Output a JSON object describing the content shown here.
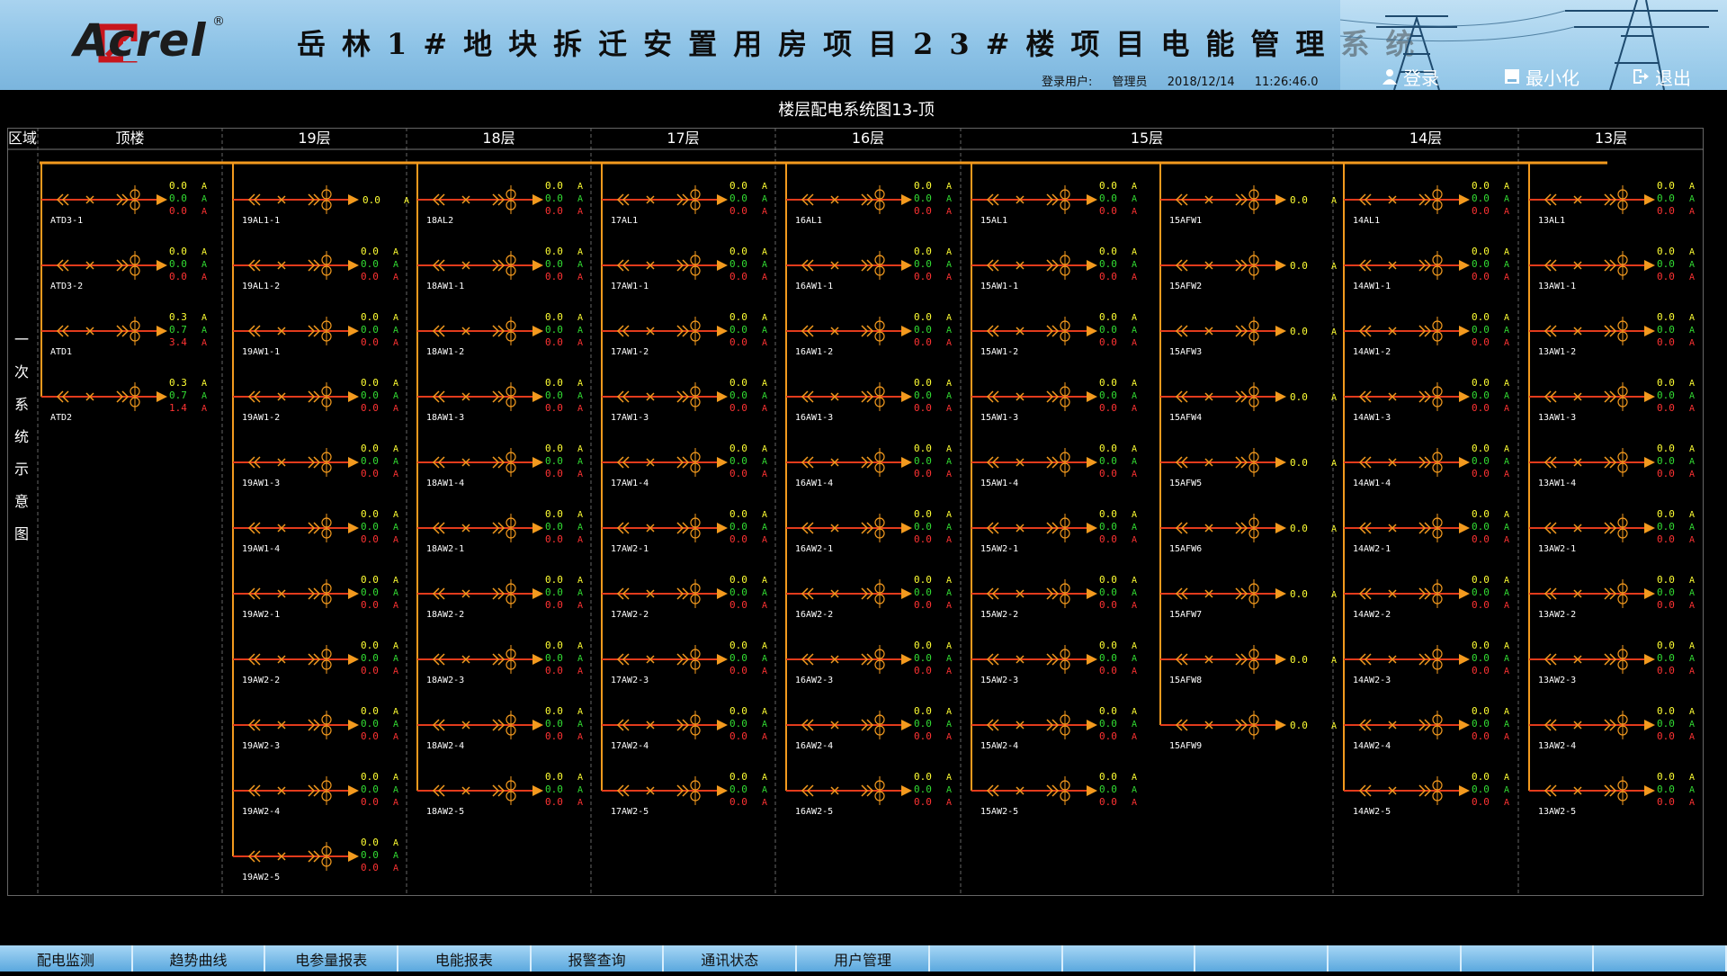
{
  "header": {
    "logo_text": "Acrel",
    "logo_reg": "®",
    "title": "岳林1#地块拆迁安置用房项目23#楼项目电能管理系统",
    "user_label": "登录用户:",
    "user_name": "管理员",
    "date": "2018/12/14",
    "time": "11:26:46.0",
    "buttons": {
      "login": "登录",
      "minimize": "最小化",
      "exit": "退出"
    }
  },
  "diagram": {
    "title": "楼层配电系统图13-顶",
    "region_label": "区域",
    "side_label": [
      "一",
      "次",
      "系",
      "统",
      "示",
      "意",
      "图"
    ],
    "colors": {
      "bus": "#f39a1e",
      "line": "#e23b1c",
      "breaker": "#f39a1e",
      "val1": "#ffff33",
      "val2": "#33dd33",
      "val3": "#ff3333"
    },
    "columns": [
      {
        "header": "顶楼",
        "feeders": [
          {
            "label": "ATD3-1",
            "values": [
              "0.0",
              "0.0",
              "0.0"
            ]
          },
          {
            "label": "ATD3-2",
            "values": [
              "0.0",
              "0.0",
              "0.0"
            ]
          },
          {
            "label": "ATD1",
            "values": [
              "0.3",
              "0.7",
              "3.4"
            ]
          },
          {
            "label": "ATD2",
            "values": [
              "0.3",
              "0.7",
              "1.4"
            ]
          }
        ]
      },
      {
        "header": "19层",
        "feeders": [
          {
            "label": "19AL1-1",
            "values": [
              "0.0"
            ]
          },
          {
            "label": "19AL1-2",
            "values": [
              "0.0",
              "0.0",
              "0.0"
            ]
          },
          {
            "label": "19AW1-1",
            "values": [
              "0.0",
              "0.0",
              "0.0"
            ]
          },
          {
            "label": "19AW1-2",
            "values": [
              "0.0",
              "0.0",
              "0.0"
            ]
          },
          {
            "label": "19AW1-3",
            "values": [
              "0.0",
              "0.0",
              "0.0"
            ]
          },
          {
            "label": "19AW1-4",
            "values": [
              "0.0",
              "0.0",
              "0.0"
            ]
          },
          {
            "label": "19AW2-1",
            "values": [
              "0.0",
              "0.0",
              "0.0"
            ]
          },
          {
            "label": "19AW2-2",
            "values": [
              "0.0",
              "0.0",
              "0.0"
            ]
          },
          {
            "label": "19AW2-3",
            "values": [
              "0.0",
              "0.0",
              "0.0"
            ]
          },
          {
            "label": "19AW2-4",
            "values": [
              "0.0",
              "0.0",
              "0.0"
            ]
          },
          {
            "label": "19AW2-5",
            "values": [
              "0.0",
              "0.0",
              "0.0"
            ]
          }
        ]
      },
      {
        "header": "18层",
        "feeders": [
          {
            "label": "18AL2",
            "values": [
              "0.0",
              "0.0",
              "0.0"
            ]
          },
          {
            "label": "18AW1-1",
            "values": [
              "0.0",
              "0.0",
              "0.0"
            ]
          },
          {
            "label": "18AW1-2",
            "values": [
              "0.0",
              "0.0",
              "0.0"
            ]
          },
          {
            "label": "18AW1-3",
            "values": [
              "0.0",
              "0.0",
              "0.0"
            ]
          },
          {
            "label": "18AW1-4",
            "values": [
              "0.0",
              "0.0",
              "0.0"
            ]
          },
          {
            "label": "18AW2-1",
            "values": [
              "0.0",
              "0.0",
              "0.0"
            ]
          },
          {
            "label": "18AW2-2",
            "values": [
              "0.0",
              "0.0",
              "0.0"
            ]
          },
          {
            "label": "18AW2-3",
            "values": [
              "0.0",
              "0.0",
              "0.0"
            ]
          },
          {
            "label": "18AW2-4",
            "values": [
              "0.0",
              "0.0",
              "0.0"
            ]
          },
          {
            "label": "18AW2-5",
            "values": [
              "0.0",
              "0.0",
              "0.0"
            ]
          }
        ]
      },
      {
        "header": "17层",
        "feeders": [
          {
            "label": "17AL1",
            "values": [
              "0.0",
              "0.0",
              "0.0"
            ]
          },
          {
            "label": "17AW1-1",
            "values": [
              "0.0",
              "0.0",
              "0.0"
            ]
          },
          {
            "label": "17AW1-2",
            "values": [
              "0.0",
              "0.0",
              "0.0"
            ]
          },
          {
            "label": "17AW1-3",
            "values": [
              "0.0",
              "0.0",
              "0.0"
            ]
          },
          {
            "label": "17AW1-4",
            "values": [
              "0.0",
              "0.0",
              "0.0"
            ]
          },
          {
            "label": "17AW2-1",
            "values": [
              "0.0",
              "0.0",
              "0.0"
            ]
          },
          {
            "label": "17AW2-2",
            "values": [
              "0.0",
              "0.0",
              "0.0"
            ]
          },
          {
            "label": "17AW2-3",
            "values": [
              "0.0",
              "0.0",
              "0.0"
            ]
          },
          {
            "label": "17AW2-4",
            "values": [
              "0.0",
              "0.0",
              "0.0"
            ]
          },
          {
            "label": "17AW2-5",
            "values": [
              "0.0",
              "0.0",
              "0.0"
            ]
          }
        ]
      },
      {
        "header": "16层",
        "feeders": [
          {
            "label": "16AL1",
            "values": [
              "0.0",
              "0.0",
              "0.0"
            ]
          },
          {
            "label": "16AW1-1",
            "values": [
              "0.0",
              "0.0",
              "0.0"
            ]
          },
          {
            "label": "16AW1-2",
            "values": [
              "0.0",
              "0.0",
              "0.0"
            ]
          },
          {
            "label": "16AW1-3",
            "values": [
              "0.0",
              "0.0",
              "0.0"
            ]
          },
          {
            "label": "16AW1-4",
            "values": [
              "0.0",
              "0.0",
              "0.0"
            ]
          },
          {
            "label": "16AW2-1",
            "values": [
              "0.0",
              "0.0",
              "0.0"
            ]
          },
          {
            "label": "16AW2-2",
            "values": [
              "0.0",
              "0.0",
              "0.0"
            ]
          },
          {
            "label": "16AW2-3",
            "values": [
              "0.0",
              "0.0",
              "0.0"
            ]
          },
          {
            "label": "16AW2-4",
            "values": [
              "0.0",
              "0.0",
              "0.0"
            ]
          },
          {
            "label": "16AW2-5",
            "values": [
              "0.0",
              "0.0",
              "0.0"
            ]
          }
        ]
      },
      {
        "header": "15层",
        "feeders": [
          {
            "label": "15AL1",
            "values": [
              "0.0",
              "0.0",
              "0.0"
            ]
          },
          {
            "label": "15AW1-1",
            "values": [
              "0.0",
              "0.0",
              "0.0"
            ]
          },
          {
            "label": "15AW1-2",
            "values": [
              "0.0",
              "0.0",
              "0.0"
            ]
          },
          {
            "label": "15AW1-3",
            "values": [
              "0.0",
              "0.0",
              "0.0"
            ]
          },
          {
            "label": "15AW1-4",
            "values": [
              "0.0",
              "0.0",
              "0.0"
            ]
          },
          {
            "label": "15AW2-1",
            "values": [
              "0.0",
              "0.0",
              "0.0"
            ]
          },
          {
            "label": "15AW2-2",
            "values": [
              "0.0",
              "0.0",
              "0.0"
            ]
          },
          {
            "label": "15AW2-3",
            "values": [
              "0.0",
              "0.0",
              "0.0"
            ]
          },
          {
            "label": "15AW2-4",
            "values": [
              "0.0",
              "0.0",
              "0.0"
            ]
          },
          {
            "label": "15AW2-5",
            "values": [
              "0.0",
              "0.0",
              "0.0"
            ]
          }
        ]
      },
      {
        "header": "",
        "feeders": [
          {
            "label": "15AFW1",
            "values": [
              "0.0"
            ]
          },
          {
            "label": "15AFW2",
            "values": [
              "0.0"
            ]
          },
          {
            "label": "15AFW3",
            "values": [
              "0.0"
            ]
          },
          {
            "label": "15AFW4",
            "values": [
              "0.0"
            ]
          },
          {
            "label": "15AFW5",
            "values": [
              "0.0"
            ]
          },
          {
            "label": "15AFW6",
            "values": [
              "0.0"
            ]
          },
          {
            "label": "15AFW7",
            "values": [
              "0.0"
            ]
          },
          {
            "label": "15AFW8",
            "values": [
              "0.0"
            ]
          },
          {
            "label": "15AFW9",
            "values": [
              "0.0"
            ]
          }
        ]
      },
      {
        "header": "14层",
        "feeders": [
          {
            "label": "14AL1",
            "values": [
              "0.0",
              "0.0",
              "0.0"
            ]
          },
          {
            "label": "14AW1-1",
            "values": [
              "0.0",
              "0.0",
              "0.0"
            ]
          },
          {
            "label": "14AW1-2",
            "values": [
              "0.0",
              "0.0",
              "0.0"
            ]
          },
          {
            "label": "14AW1-3",
            "values": [
              "0.0",
              "0.0",
              "0.0"
            ]
          },
          {
            "label": "14AW1-4",
            "values": [
              "0.0",
              "0.0",
              "0.0"
            ]
          },
          {
            "label": "14AW2-1",
            "values": [
              "0.0",
              "0.0",
              "0.0"
            ]
          },
          {
            "label": "14AW2-2",
            "values": [
              "0.0",
              "0.0",
              "0.0"
            ]
          },
          {
            "label": "14AW2-3",
            "values": [
              "0.0",
              "0.0",
              "0.0"
            ]
          },
          {
            "label": "14AW2-4",
            "values": [
              "0.0",
              "0.0",
              "0.0"
            ]
          },
          {
            "label": "14AW2-5",
            "values": [
              "0.0",
              "0.0",
              "0.0"
            ]
          }
        ]
      },
      {
        "header": "13层",
        "feeders": [
          {
            "label": "13AL1",
            "values": [
              "0.0",
              "0.0",
              "0.0"
            ]
          },
          {
            "label": "13AW1-1",
            "values": [
              "0.0",
              "0.0",
              "0.0"
            ]
          },
          {
            "label": "13AW1-2",
            "values": [
              "0.0",
              "0.0",
              "0.0"
            ]
          },
          {
            "label": "13AW1-3",
            "values": [
              "0.0",
              "0.0",
              "0.0"
            ]
          },
          {
            "label": "13AW1-4",
            "values": [
              "0.0",
              "0.0",
              "0.0"
            ]
          },
          {
            "label": "13AW2-1",
            "values": [
              "0.0",
              "0.0",
              "0.0"
            ]
          },
          {
            "label": "13AW2-2",
            "values": [
              "0.0",
              "0.0",
              "0.0"
            ]
          },
          {
            "label": "13AW2-3",
            "values": [
              "0.0",
              "0.0",
              "0.0"
            ]
          },
          {
            "label": "13AW2-4",
            "values": [
              "0.0",
              "0.0",
              "0.0"
            ]
          },
          {
            "label": "13AW2-5",
            "values": [
              "0.0",
              "0.0",
              "0.0"
            ]
          }
        ]
      }
    ],
    "unit": "A"
  },
  "nav": {
    "items": [
      "配电监测",
      "趋势曲线",
      "电参量报表",
      "电能报表",
      "报警查询",
      "通讯状态",
      "用户管理",
      "",
      "",
      "",
      "",
      "",
      ""
    ]
  }
}
